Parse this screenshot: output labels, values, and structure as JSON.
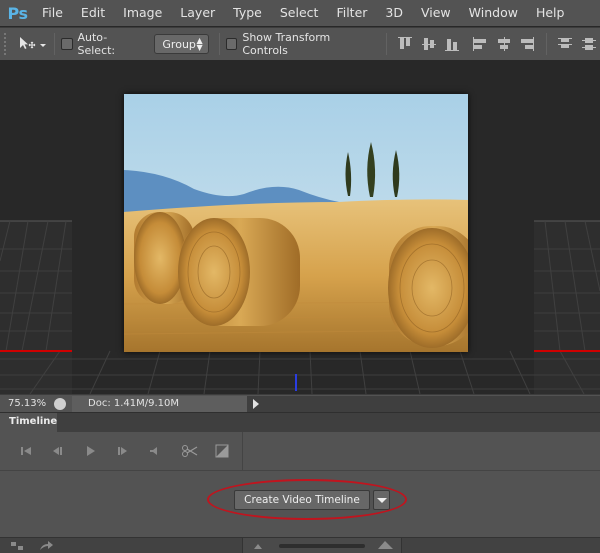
{
  "app": {
    "logo": "Ps"
  },
  "menu": [
    "File",
    "Edit",
    "Image",
    "Layer",
    "Type",
    "Select",
    "Filter",
    "3D",
    "View",
    "Window",
    "Help"
  ],
  "options": {
    "auto_select_label": "Auto-Select:",
    "auto_select_value": "Group",
    "show_transform_label": "Show Transform Controls"
  },
  "status": {
    "zoom": "75.13%",
    "doc": "Doc: 1.41M/9.10M"
  },
  "timeline": {
    "tab_label": "Timeline",
    "create_button_label": "Create Video Timeline"
  },
  "colors": {
    "highlight": "#c1141e",
    "accent_red_line": "#d00000",
    "accent_blue_marker": "#2a3de0"
  }
}
